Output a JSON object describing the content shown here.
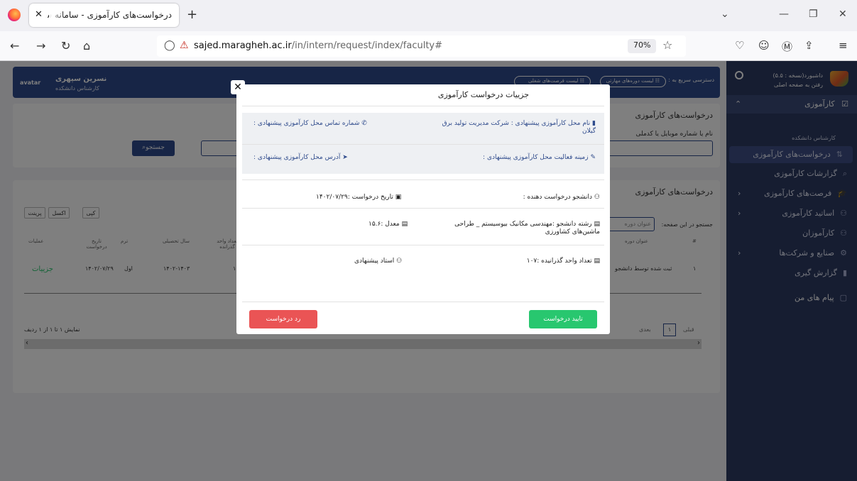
{
  "browser": {
    "tab_title": "درخواست‌های کارآموزی - سامانه ساجد",
    "url_domain": "sajed.maragheh.ac.ir",
    "url_path": "/in/intern/request/index/faculty#",
    "url_prefix": "",
    "zoom": "70%"
  },
  "topbar": {
    "avatar": "avatar",
    "user_name": "نسرین سپهری",
    "user_role": "کارشناس دانشکده",
    "quick_access": "دسترسی سریع به :",
    "quick_1": "☷ لیست دوره‌های مهارتی",
    "quick_2": "☷ لیست فرصت‌های شغلی"
  },
  "sidebar": {
    "app_title": "داشبورد(نسخه : ۵.۵)",
    "app_sub": "رفتن به صفحه اصلی",
    "section": "کارآموزی",
    "role_label": "کارشناس دانشکده",
    "items": [
      {
        "label": "درخواست‌های کارآموزی",
        "icon": "⇅"
      },
      {
        "label": "گزارشات کارآموزی",
        "icon": "⌕"
      },
      {
        "label": "فرصت‌های کارآموزی",
        "icon": "🎓"
      },
      {
        "label": "اساتید کارآموزی",
        "icon": "⚇"
      },
      {
        "label": "کارآموزان",
        "icon": "⚇"
      },
      {
        "label": "صنایع و شرکت‌ها",
        "icon": "⚙"
      },
      {
        "label": "گزارش گیری",
        "icon": "▮"
      },
      {
        "label": "پیام های من",
        "icon": "▢"
      }
    ]
  },
  "page": {
    "search_card_title": "درخواست‌های کارآموزی",
    "search_label": "نام یا شماره موبایل یا کدملی",
    "search_button": "جستجو",
    "table_card_title": "درخواست‌های کارآموزی",
    "table_search_label": "جستجو در این صفحه:",
    "table_search_placeholder": "عنوان دوره",
    "btn_copy": "کپی",
    "btn_excel": "اکسل",
    "btn_print": "پرینت",
    "headers": [
      "#",
      "عنوان دوره",
      "تعداد واحد گذرانده",
      "سال تحصیلی",
      "ترم",
      "تاریخ درخواست",
      "عملیات"
    ],
    "row": {
      "num": "۱",
      "title": "ثبت شده توسط دانشجو",
      "units": "۱",
      "year": "۱۴۰۲-۱۴۰۳",
      "term": "اول",
      "date": "۱۴۰۲/۰۷/۲۹",
      "action": "جزییات"
    },
    "footer_info": "نمایش ۱ تا ۱ از ۱ ردیف",
    "pager_prev": "قبلی",
    "pager_page": "۱",
    "pager_next": "بعدی"
  },
  "modal": {
    "title": "جزییات درخواست کارآموزی",
    "place_name_label": "نام محل کارآموزی پیشنهادی : شرکت مدیریت تولید برق گیلان",
    "place_phone_label": "شماره تماس محل کارآموزی پیشنهادی :",
    "place_field_label": "زمینه فعالیت محل کارآموزی پیشنهادی :",
    "place_address_label": "آدرس محل کارآموزی پیشنهادی :",
    "student_label": "دانشجو درخواست دهنده :",
    "request_date_label": "تاریخ درخواست :۱۴۰۲/۰۷/۲۹",
    "major_label": "رشته دانشجو :مهندسی مکانیک بیوسیستم _ طراحی ماشین‌های کشاورزی",
    "gpa_label": "معدل :۱۵.۶",
    "units_label": "تعداد واحد گذرانیده :۱۰۷",
    "advisor_label": "استاد پیشنهادی",
    "approve_button": "تایید درخواست",
    "reject_button": "رد درخواست"
  }
}
